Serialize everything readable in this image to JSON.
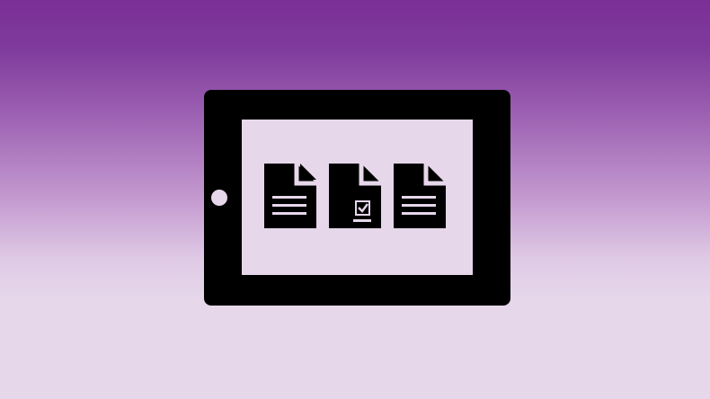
{
  "icons": {
    "device": "tablet-icon",
    "documents": [
      {
        "name": "document-lines-icon"
      },
      {
        "name": "document-checkbox-icon"
      },
      {
        "name": "document-lines-icon"
      }
    ]
  },
  "colors": {
    "background_top": "#7a2f96",
    "background_bottom": "#e6d7ea",
    "device_body": "#000000",
    "screen": "#e6d7ea"
  }
}
